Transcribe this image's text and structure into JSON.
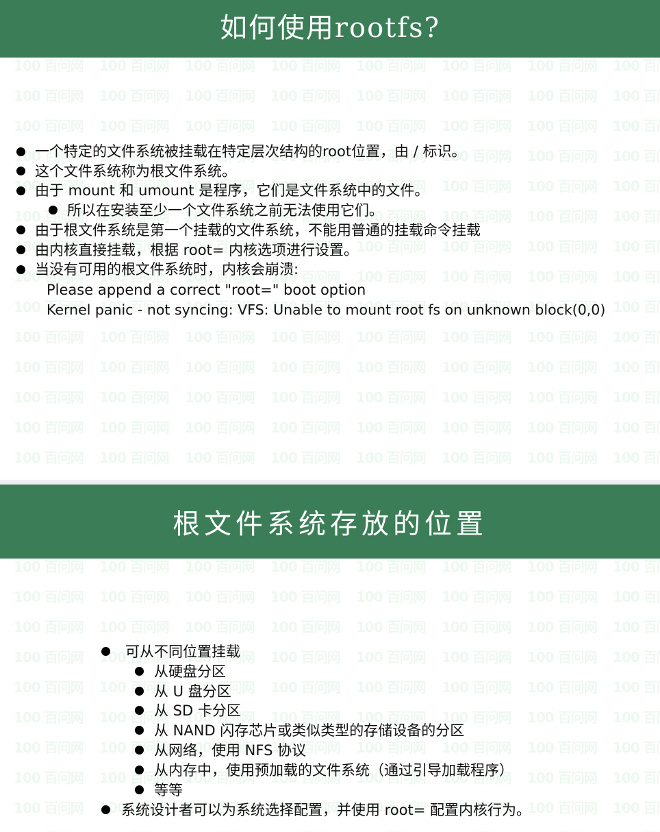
{
  "slide1": {
    "title": "如何使用rootfs?",
    "items": [
      {
        "level": 1,
        "text": "一个特定的文件系统被挂载在特定层次结构的root位置，由 / 标识。"
      },
      {
        "level": 1,
        "text": "这个文件系统称为根文件系统。"
      },
      {
        "level": 1,
        "text": "由于 mount 和 umount 是程序，它们是文件系统中的文件。"
      },
      {
        "level": 2,
        "text": "所以在安装至少一个文件系统之前无法使用它们。"
      },
      {
        "level": 1,
        "text": "由于根文件系统是第一个挂载的文件系统，不能用普通的挂载命令挂载"
      },
      {
        "level": 1,
        "text": "由内核直接挂载，根据 root=  内核选项进行设置。"
      },
      {
        "level": 1,
        "text": "当没有可用的根文件系统时，内核会崩溃:"
      },
      {
        "level": 0,
        "text": "Please append a correct \"root=\" boot option"
      },
      {
        "level": 0,
        "text": "Kernel panic - not syncing: VFS: Unable to mount root fs on unknown block(0,0)"
      }
    ]
  },
  "slide2": {
    "title": "根文件系统存放的位置",
    "items": [
      {
        "level": 1,
        "text": "可从不同位置挂载"
      },
      {
        "level": 2,
        "text": "从硬盘分区"
      },
      {
        "level": 2,
        "text": "从 U 盘分区"
      },
      {
        "level": 2,
        "text": "从 SD 卡分区"
      },
      {
        "level": 2,
        "text": "从 NAND 闪存芯片或类似类型的存储设备的分区"
      },
      {
        "level": 2,
        "text": "从网络，使用 NFS 协议"
      },
      {
        "level": 2,
        "text": "从内存中，使用预加载的文件系统（通过引导加载程序）"
      },
      {
        "level": 2,
        "text": "等等"
      },
      {
        "level": 1,
        "text": "系统设计者可以为系统选择配置，并使用 root= 配置内核行为。"
      }
    ]
  },
  "watermark": {
    "text": "100 百问网"
  },
  "colors": {
    "title_bar": "#3a7d57",
    "title_text": "#ffffff",
    "watermark": "#78c88c"
  }
}
